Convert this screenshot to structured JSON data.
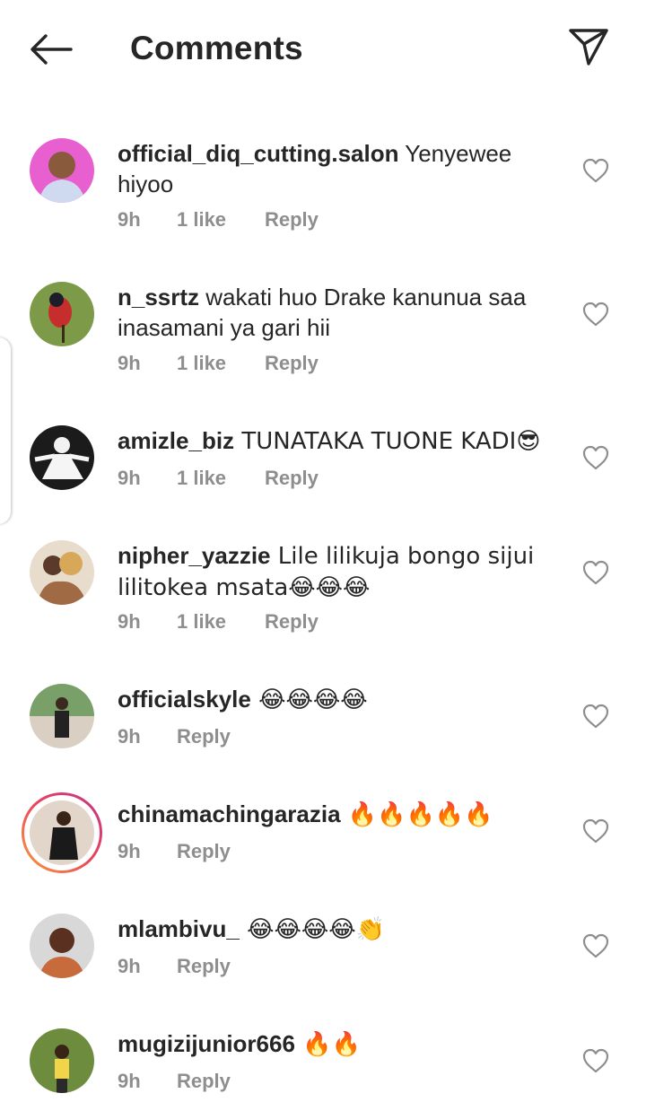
{
  "header": {
    "title": "Comments",
    "back_icon": "arrow-left-icon",
    "share_icon": "paper-plane-icon"
  },
  "comments": [
    {
      "username": "official_diq_cutting.salon",
      "text": " Yenyewee hiyoo",
      "time": "9h",
      "likes": "1 like",
      "reply": "Reply",
      "avatar_color": "#e85fd0",
      "has_story_ring": false
    },
    {
      "username": "n_ssrtz",
      "text": " wakati huo Drake kanunua saa inasamani ya gari hii",
      "time": "9h",
      "likes": "1 like",
      "reply": "Reply",
      "avatar_color": "#6f8a3a",
      "has_story_ring": false
    },
    {
      "username": "amizle_biz",
      "text": " TUNATAKA TUONE KADI😎",
      "time": "9h",
      "likes": "1 like",
      "reply": "Reply",
      "avatar_color": "#1b1b1b",
      "has_story_ring": false
    },
    {
      "username": "nipher_yazzie",
      "text": " Lile lilikuja bongo sijui lilitokea msata😂😂😂",
      "time": "9h",
      "likes": "1 like",
      "reply": "Reply",
      "avatar_color": "#c99a6b",
      "has_story_ring": false
    },
    {
      "username": "officialskyle",
      "text": " 😂😂😂😂",
      "time": "9h",
      "likes": "",
      "reply": "Reply",
      "avatar_color": "#d9cfc2",
      "has_story_ring": false
    },
    {
      "username": "chinamachingarazia",
      "text": " 🔥🔥🔥🔥🔥",
      "time": "9h",
      "likes": "",
      "reply": "Reply",
      "avatar_color": "#e2d6ca",
      "has_story_ring": true
    },
    {
      "username": "mlambivu_",
      "text": " 😂😂😂😂👏",
      "time": "9h",
      "likes": "",
      "reply": "Reply",
      "avatar_color": "#a2643c",
      "has_story_ring": false
    },
    {
      "username": "mugizijunior666",
      "text": " 🔥🔥",
      "time": "9h",
      "likes": "",
      "reply": "Reply",
      "avatar_color": "#6d8c3e",
      "has_story_ring": false
    }
  ],
  "heart_icon": "heart-outline-icon"
}
